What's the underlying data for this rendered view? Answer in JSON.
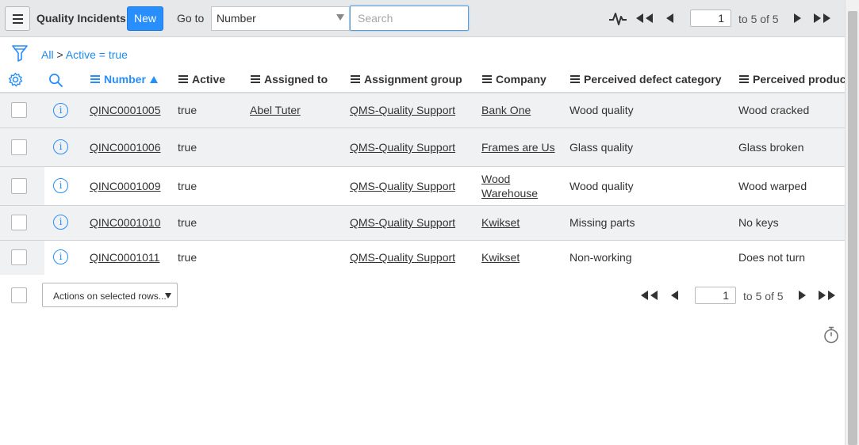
{
  "header": {
    "title": "Quality Incidents",
    "new_label": "New",
    "goto_label": "Go to",
    "goto_field": "Number",
    "search_placeholder": "Search"
  },
  "pagination": {
    "current_page": "1",
    "range_text": "to 5 of 5"
  },
  "breadcrumb": {
    "all": "All",
    "separator": ">",
    "filter": "Active = true"
  },
  "columns": [
    {
      "label": "Number",
      "sorted": "ascending"
    },
    {
      "label": "Active"
    },
    {
      "label": "Assigned to"
    },
    {
      "label": "Assignment group"
    },
    {
      "label": "Company"
    },
    {
      "label": "Perceived defect category"
    },
    {
      "label": "Perceived product"
    }
  ],
  "rows": [
    {
      "number": "QINC0001005",
      "active": "true",
      "assigned_to": "Abel Tuter",
      "group": "QMS-Quality Support",
      "company_line1": "Bank One",
      "company_line2": "",
      "category": "Wood quality",
      "product": "Wood cracked"
    },
    {
      "number": "QINC0001006",
      "active": "true",
      "assigned_to": "",
      "group": "QMS-Quality Support",
      "company_line1": "Frames are Us",
      "company_line2": "",
      "category": "Glass quality",
      "product": "Glass broken"
    },
    {
      "number": "QINC0001009",
      "active": "true",
      "assigned_to": "",
      "group": "QMS-Quality Support",
      "company_line1": "Wood",
      "company_line2": "Warehouse",
      "category": "Wood quality",
      "product": "Wood warped"
    },
    {
      "number": "QINC0001010",
      "active": "true",
      "assigned_to": "",
      "group": "QMS-Quality Support",
      "company_line1": "Kwikset",
      "company_line2": "",
      "category": "Missing parts",
      "product": "No keys"
    },
    {
      "number": "QINC0001011",
      "active": "true",
      "assigned_to": "",
      "group": "QMS-Quality Support",
      "company_line1": "Kwikset",
      "company_line2": "",
      "category": "Non-working",
      "product": "Does not turn"
    }
  ],
  "footer": {
    "actions_label": "Actions on selected rows...",
    "current_page": "1",
    "range_text": "to 5 of 5"
  },
  "colors": {
    "accent": "#278efc",
    "header_bg": "#e6e8ea",
    "row_alt_bg": "#f0f1f2"
  },
  "icons": [
    "menu-icon",
    "activity-stream-icon",
    "first-page-icon",
    "previous-page-icon",
    "next-page-icon",
    "last-page-icon",
    "filter-icon",
    "gear-icon",
    "search-icon",
    "info-icon",
    "stopwatch-icon"
  ]
}
